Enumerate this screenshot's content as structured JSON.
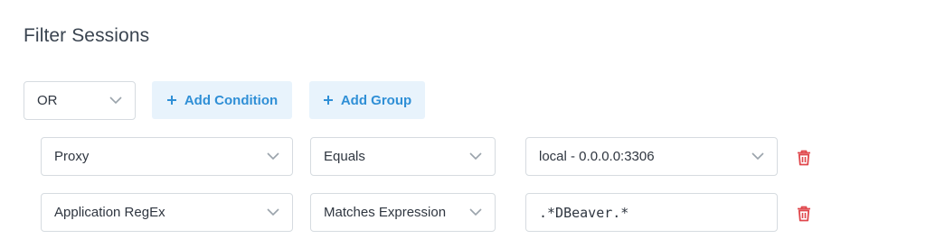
{
  "header": {
    "title": "Filter Sessions"
  },
  "toolbar": {
    "operator": "OR",
    "add_condition_label": "Add Condition",
    "add_group_label": "Add Group"
  },
  "conditions": [
    {
      "field": "Proxy",
      "comparator": "Equals",
      "value": "local - 0.0.0.0:3306",
      "value_type": "select"
    },
    {
      "field": "Application RegEx",
      "comparator": "Matches Expression",
      "value": ".*DBeaver.*",
      "value_type": "text"
    }
  ],
  "colors": {
    "accent": "#2f8fd6",
    "accent_bg": "#e8f3fc",
    "danger": "#e0474c",
    "border": "#d6dbe0"
  },
  "icons": {
    "chevron": "chevron-down-icon",
    "plus": "plus-icon",
    "delete": "trash-icon"
  }
}
